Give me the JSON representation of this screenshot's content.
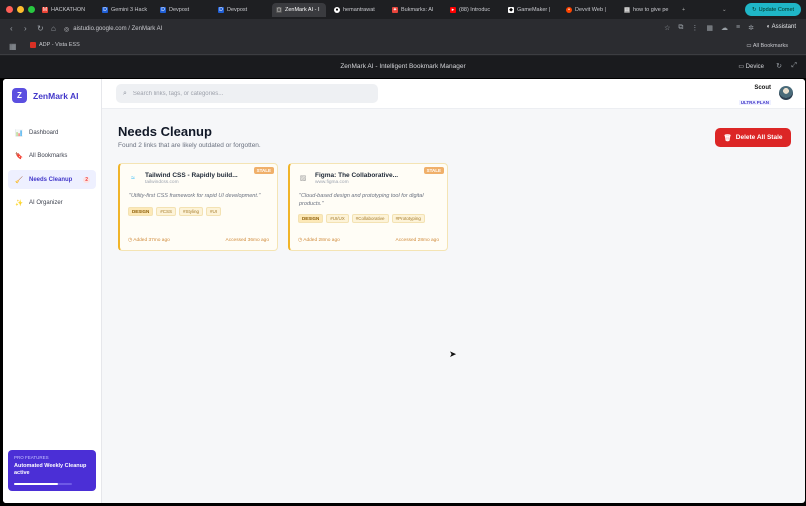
{
  "browser": {
    "tabs": [
      {
        "label": "HACKATHON",
        "icon": "gmail-icon"
      },
      {
        "label": "Gemini 3 Hack",
        "icon": "devpost-icon"
      },
      {
        "label": "Devpost",
        "icon": "devpost-icon"
      },
      {
        "label": "Devpost",
        "icon": "devpost-icon"
      },
      {
        "label": "ZenMark AI - I",
        "icon": "studio-icon",
        "active": true
      },
      {
        "label": "hemantrawat",
        "icon": "github-icon"
      },
      {
        "label": "Bukmarks: AI",
        "icon": "bookmark-icon"
      },
      {
        "label": "(88) Introduc",
        "icon": "youtube-icon"
      },
      {
        "label": "GameMaker |",
        "icon": "gamemaker-icon"
      },
      {
        "label": "Devvit Web |",
        "icon": "reddit-icon"
      },
      {
        "label": "how to give pe",
        "icon": "page-icon"
      }
    ],
    "update_button": "Update Comet",
    "url": "aistudio.google.com / ZenMark AI",
    "assistant_label": "Assistant",
    "bookmark_bar": {
      "item": "ADP - Vista ESS",
      "all_bookmarks": "All Bookmarks"
    },
    "studio_title": "ZenMark AI - Intelligent Bookmark Manager",
    "device_label": "Device"
  },
  "app": {
    "brand": {
      "initial": "Z",
      "name": "ZenMark AI"
    },
    "nav": [
      {
        "label": "Dashboard",
        "icon": "chart-icon"
      },
      {
        "label": "All Bookmarks",
        "icon": "bookmark-icon"
      },
      {
        "label": "Needs Cleanup",
        "icon": "broom-icon",
        "count": "2",
        "active": true
      },
      {
        "label": "AI Organizer",
        "icon": "sparkle-icon"
      }
    ],
    "promo": {
      "kicker": "PRO FEATURES",
      "text": "Automated Weekly Cleanup active",
      "progress": 0.75
    },
    "search": {
      "placeholder": "Search links, tags, or categories..."
    },
    "user": {
      "name": "Scout",
      "plan": "ULTRA PLAN"
    },
    "page": {
      "title": "Needs Cleanup",
      "subtitle": "Found 2 links that are likely outdated or forgotten.",
      "delete_button": "Delete All Stale"
    },
    "cards": [
      {
        "title": "Tailwind CSS - Rapidly build...",
        "domain": "tailwindcss.com",
        "badge": "STALE",
        "description": "\"Utility-first CSS framework for rapid UI development.\"",
        "category": "DESIGN",
        "tags": [
          "#CSS",
          "#Styling",
          "#UI"
        ],
        "added": "Added 37mo ago",
        "accessed": "Accessed 36mo ago"
      },
      {
        "title": "Figma: The Collaborative...",
        "domain": "www.figma.com",
        "badge": "STALE",
        "description": "\"Cloud-based design and prototyping tool for digital products.\"",
        "category": "DESIGN",
        "tags": [
          "#UI/UX",
          "#Collaborative",
          "#Prototyping"
        ],
        "added": "Added 28mo ago",
        "accessed": "Accessed 28mo ago"
      }
    ]
  },
  "colors": {
    "accent": "#4338ca",
    "danger": "#dc2626",
    "stale": "#f0b429"
  }
}
